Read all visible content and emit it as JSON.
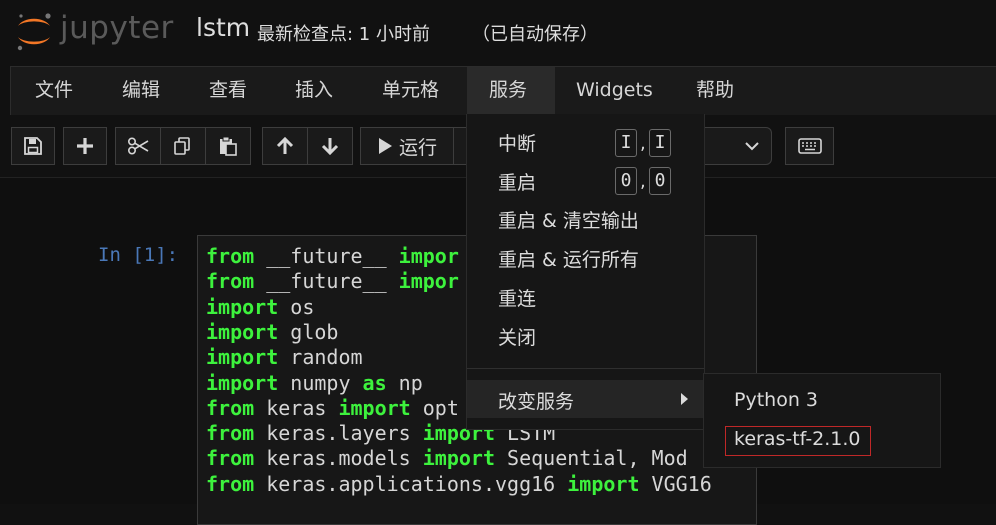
{
  "header": {
    "logo_text": "jupyter",
    "notebook_name": "lstm",
    "checkpoint": "最新检查点: 1 小时前",
    "autosave": "（已自动保存）"
  },
  "menubar": {
    "items": [
      "文件",
      "编辑",
      "查看",
      "插入",
      "单元格",
      "服务",
      "Widgets",
      "帮助"
    ],
    "active": "服务"
  },
  "toolbar": {
    "save_icon": "floppy-disk-icon",
    "add_icon": "plus-icon",
    "cut_icon": "scissors-icon",
    "copy_icon": "copy-icon",
    "paste_icon": "paste-icon",
    "up_icon": "arrow-up-icon",
    "down_icon": "arrow-down-icon",
    "run_label": "运行",
    "keyboard_icon": "keyboard-icon"
  },
  "cell": {
    "prompt": "In [1]:",
    "lines": [
      [
        {
          "t": "from",
          "k": 1
        },
        {
          "t": " __future__ ",
          "k": 0
        },
        {
          "t": "impor",
          "k": 1
        }
      ],
      [
        {
          "t": "from",
          "k": 1
        },
        {
          "t": " __future__ ",
          "k": 0
        },
        {
          "t": "impor",
          "k": 1
        }
      ],
      [
        {
          "t": "import",
          "k": 1
        },
        {
          "t": " os",
          "k": 0
        }
      ],
      [
        {
          "t": "import",
          "k": 1
        },
        {
          "t": " glob",
          "k": 0
        }
      ],
      [
        {
          "t": "import",
          "k": 1
        },
        {
          "t": " random",
          "k": 0
        }
      ],
      [
        {
          "t": "import",
          "k": 1
        },
        {
          "t": " numpy ",
          "k": 0
        },
        {
          "t": "as",
          "k": 1
        },
        {
          "t": " np",
          "k": 0
        }
      ],
      [
        {
          "t": "from",
          "k": 1
        },
        {
          "t": " keras ",
          "k": 0
        },
        {
          "t": "import",
          "k": 1
        },
        {
          "t": " opt",
          "k": 0
        }
      ],
      [
        {
          "t": "from",
          "k": 1
        },
        {
          "t": " keras.layers ",
          "k": 0
        },
        {
          "t": "import",
          "k": 1
        },
        {
          "t": " LSTM",
          "k": 0
        }
      ],
      [
        {
          "t": "from",
          "k": 1
        },
        {
          "t": " keras.models ",
          "k": 0
        },
        {
          "t": "import",
          "k": 1
        },
        {
          "t": " Sequential, Mod",
          "k": 0
        }
      ],
      [
        {
          "t": "from",
          "k": 1
        },
        {
          "t": " keras.applications.vgg16 ",
          "k": 0
        },
        {
          "t": "import",
          "k": 1
        },
        {
          "t": " VGG16",
          "k": 0
        }
      ]
    ]
  },
  "kernel_menu": {
    "items": [
      {
        "label": "中断",
        "shortcut": [
          "I",
          "I"
        ]
      },
      {
        "label": "重启",
        "shortcut": [
          "0",
          "0"
        ]
      },
      {
        "label": "重启 & 清空输出",
        "shortcut": []
      },
      {
        "label": "重启 & 运行所有",
        "shortcut": []
      },
      {
        "label": "重连",
        "shortcut": []
      },
      {
        "label": "关闭",
        "shortcut": []
      }
    ],
    "submenu_label": "改变服务",
    "submenu": [
      "Python 3",
      "keras-tf-2.1.0"
    ],
    "highlighted_kernel": "keras-tf-2.1.0"
  },
  "colors": {
    "background": "#111111",
    "keyword": "#3df23d",
    "prompt": "#4a78b8",
    "highlight_border": "#c02828",
    "logo_orange": "#f37726"
  }
}
